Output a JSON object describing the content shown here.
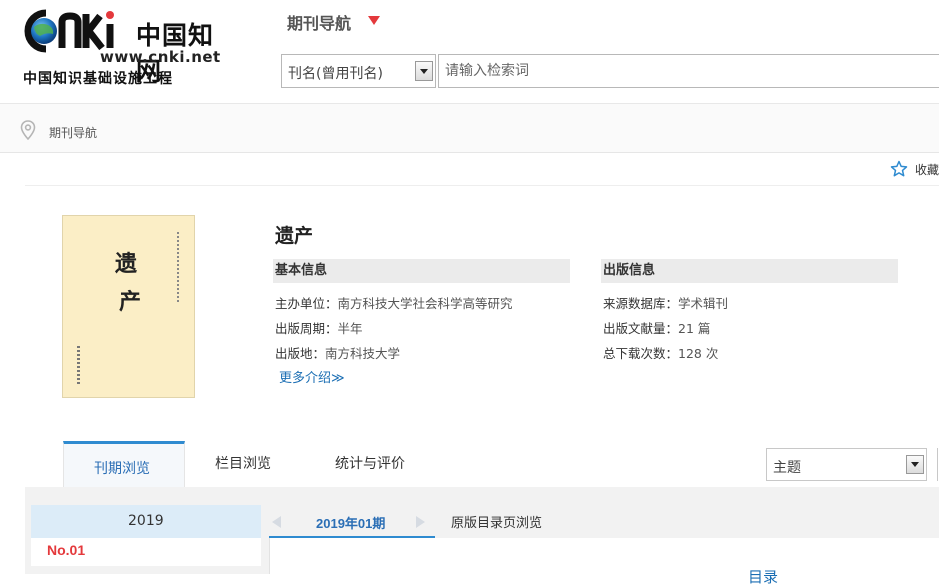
{
  "logo": {
    "brand_cn": "中国知网",
    "url": "www.cnki.net",
    "tagline": "中国知识基础设施工程"
  },
  "header": {
    "nav_title": "期刊导航",
    "search_field": "刊名(曾用刊名)",
    "search_placeholder": "请输入检索词"
  },
  "breadcrumb": {
    "current": "期刊导航"
  },
  "favorite_label": "收藏",
  "journal": {
    "title": "遗产",
    "cover_title_1": "遗",
    "cover_title_2": "产",
    "basic_info": {
      "heading": "基本信息",
      "rows": [
        {
          "label": "主办单位：",
          "value": "南方科技大学社会科学高等研究"
        },
        {
          "label": "出版周期：",
          "value": "半年"
        },
        {
          "label": "出版地：",
          "value": "南方科技大学"
        }
      ]
    },
    "pub_info": {
      "heading": "出版信息",
      "rows": [
        {
          "label": "来源数据库：",
          "value": "学术辑刊"
        },
        {
          "label": "出版文献量：",
          "value": "21 篇"
        },
        {
          "label": "总下载次数：",
          "value": "128 次"
        }
      ]
    },
    "more_intro": "更多介绍≫"
  },
  "tabs": {
    "issue_browse": "刊期浏览",
    "column_browse": "栏目浏览",
    "stats_eval": "统计与评价"
  },
  "topic_select": "主题",
  "browse": {
    "year": "2019",
    "issue": "No.01",
    "current_issue": "2019年01期",
    "original_browse": "原版目录页浏览",
    "toc_peek": "目录"
  },
  "colors": {
    "accent": "#2f8bd0",
    "highlight": "#e4393c",
    "link": "#1c6fb4"
  }
}
